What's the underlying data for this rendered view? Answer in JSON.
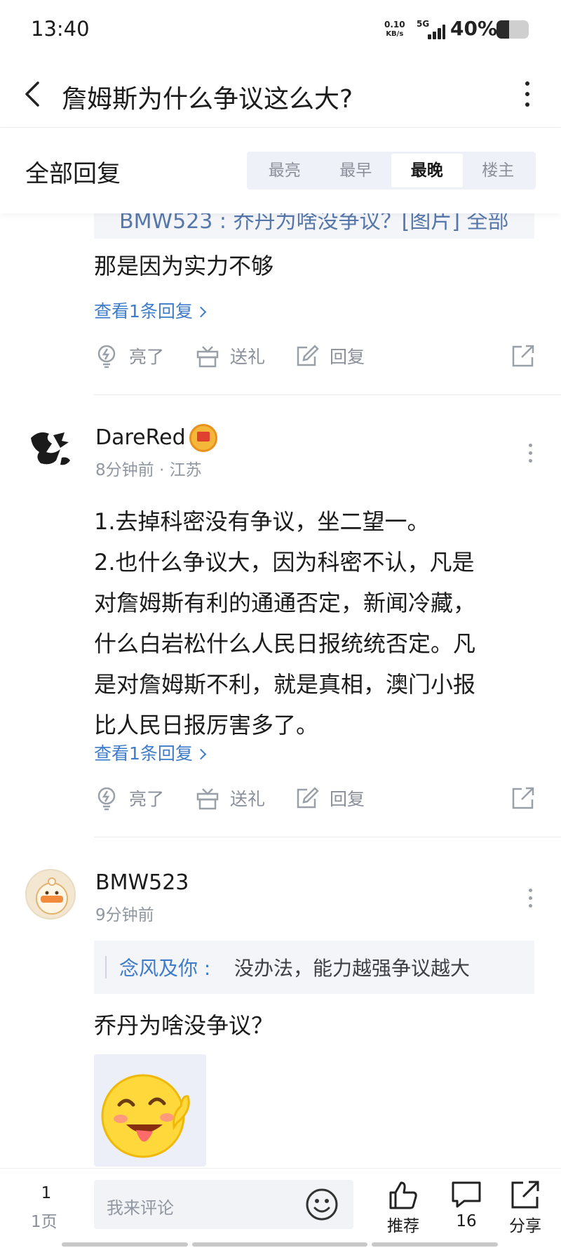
{
  "status_bar": {
    "time": "13:40",
    "net_speed": "0.10",
    "net_unit": "KB/s",
    "signal_label": "5G",
    "battery_percent": "40%",
    "battery_level": 0.4
  },
  "nav": {
    "title": "詹姆斯为什么争议这么大?"
  },
  "filter": {
    "label": "全部回复",
    "tabs": [
      {
        "label": "最亮",
        "active": false
      },
      {
        "label": "最早",
        "active": false
      },
      {
        "label": "最晚",
        "active": true
      },
      {
        "label": "楼主",
        "active": false
      }
    ]
  },
  "actions": {
    "like": "亮了",
    "gift": "送礼",
    "reply": "回复"
  },
  "comments": [
    {
      "quote_partial": "BMW523 : 乔丹为啥没争议？[图片] 全部",
      "body": "那是因为实力不够",
      "view_replies": "查看1条回复"
    },
    {
      "username": "DareRed",
      "meta": "8分钟前 · 江苏",
      "body_lines": [
        "1.去掉科密没有争议，坐二望一。",
        "2.也什么争议大，因为科密不认，凡是",
        "对詹姆斯有利的通通否定，新闻冷藏，",
        "什么白岩松什么人民日报统统否定。凡",
        "是对詹姆斯不利，就是真相，澳门小报",
        "比人民日报厉害多了。"
      ],
      "view_replies": "查看1条回复"
    },
    {
      "username": "BMW523",
      "meta": "9分钟前",
      "quote_name": "念风及你 :",
      "quote_text": "没办法，能力越强争议越大",
      "body": "乔丹为啥没争议？"
    }
  ],
  "bottom_bar": {
    "page_number": "1",
    "page_unit": "1页",
    "comment_placeholder": "我来评论",
    "recommend_label": "推荐",
    "comment_count": "16",
    "share_label": "分享"
  }
}
